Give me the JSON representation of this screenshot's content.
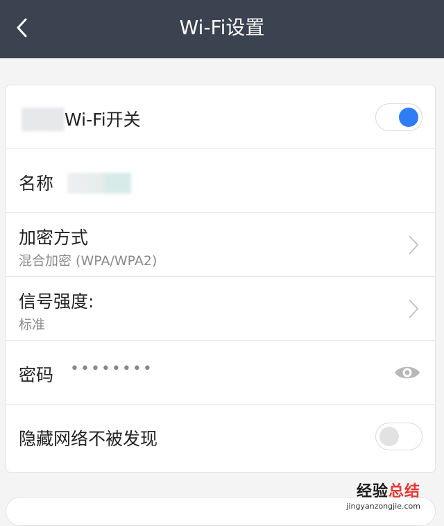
{
  "header": {
    "title": "Wi-Fi设置"
  },
  "rows": {
    "wifi_switch": {
      "label": "Wi-Fi开关",
      "enabled": true
    },
    "name": {
      "label": "名称"
    },
    "encryption": {
      "label": "加密方式",
      "value": "混合加密 (WPA/WPA2)"
    },
    "signal": {
      "label": "信号强度:",
      "value": "标准"
    },
    "password": {
      "label": "密码",
      "masked": "••••••••"
    },
    "hide_network": {
      "label": "隐藏网络不被发现",
      "enabled": false
    }
  },
  "watermark": {
    "main_a": "经验",
    "main_b": "总结",
    "sub": "jingyanzongjie.com"
  },
  "colors": {
    "header_bg": "#3b4250",
    "toggle_on": "#2e7cf6"
  }
}
